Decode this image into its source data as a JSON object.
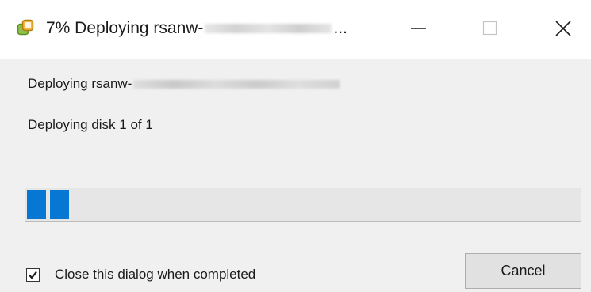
{
  "window": {
    "title_prefix": "7% Deploying rsanw-",
    "title_suffix": "...",
    "icon": "vsphere-icon",
    "controls": {
      "minimize_icon": "minimize-icon",
      "maximize_icon": "maximize-icon",
      "close_icon": "close-icon"
    }
  },
  "dialog": {
    "deploying_prefix": "Deploying rsanw-",
    "status_text": "Deploying disk 1 of 1",
    "progress_percent": 7,
    "progress_color": "#0678d4",
    "checkbox": {
      "label": "Close this dialog when completed",
      "checked": true
    },
    "cancel_label": "Cancel"
  }
}
